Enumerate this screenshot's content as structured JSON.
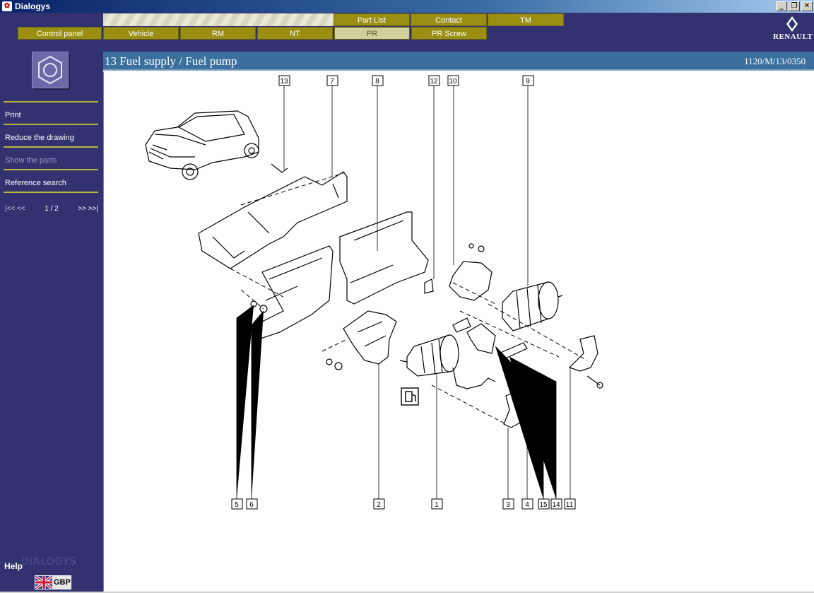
{
  "window": {
    "title": "Dialogys",
    "controls": [
      "_",
      "❐",
      "✕"
    ]
  },
  "header": {
    "top_tabs": [
      "Part List",
      "Contact",
      "TM"
    ],
    "nav_tabs": [
      "Control panel",
      "Vehicle",
      "RM",
      "NT",
      "PR",
      "PR Screw"
    ],
    "active_tab": "PR",
    "brand": "RENAULT"
  },
  "sidebar": {
    "menu": [
      {
        "label": "Print",
        "enabled": true
      },
      {
        "label": "Reduce the drawing",
        "enabled": true
      },
      {
        "label": "Show the parts",
        "enabled": false
      },
      {
        "label": "Reference search",
        "enabled": true
      }
    ],
    "pager": {
      "first_prev": "|<< <<",
      "position": "1 / 2",
      "next_last": ">> >>|"
    },
    "help": "Help",
    "watermark": "DIALOGYS",
    "language": "GBP"
  },
  "main": {
    "title": "13 Fuel supply / Fuel pump",
    "reference": "1120/M/13/0350",
    "callouts_top": [
      "13",
      "7",
      "8",
      "12",
      "10",
      "9"
    ],
    "callouts_bottom": [
      "5",
      "6",
      "2",
      "1",
      "3",
      "4",
      "15",
      "14",
      "11"
    ]
  },
  "colors": {
    "navy": "#323270",
    "tab_olive": "#9a8f12",
    "heading_blue": "#3a6f9e"
  }
}
